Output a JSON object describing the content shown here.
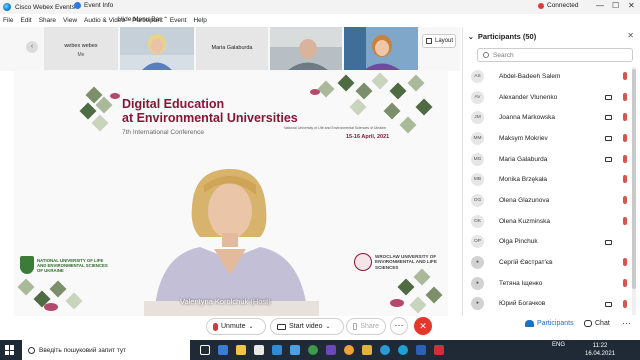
{
  "titlebar": {
    "app_title": "Cisco Webex Events",
    "event_info": "Event Info",
    "connection_status": "Connected",
    "connection_color": "#e23a3a",
    "minimize": "—",
    "maximize": "☐",
    "close": "✕"
  },
  "menubar": {
    "items": [
      "File",
      "Edit",
      "Share",
      "View",
      "Audio & Video",
      "Participant",
      "Event",
      "Help"
    ],
    "hide_menu_bar": "Hide Menu Bar",
    "hide_menu_chevron": "⌃"
  },
  "strip": {
    "prev_icon": "chevron-left-icon",
    "next_icon": "chevron-right-icon",
    "tiles": [
      {
        "name": "webex webex",
        "sub": "Me"
      },
      {
        "name": "",
        "sub": ""
      },
      {
        "name": "Maria Galaburda",
        "sub": ""
      },
      {
        "name": "",
        "sub": ""
      },
      {
        "name": "",
        "sub": ""
      }
    ],
    "layout_label": "Layout"
  },
  "slide": {
    "title_line1": "Digital Education",
    "title_line2": "at Environmental Universities",
    "subtitle": "7th International Conference",
    "uni_small": "National University of Life and Environmental Sciences of Ukraine",
    "date": "15-16 April, 2021",
    "left_logo": "NATIONAL UNIVERSITY OF LIFE AND ENVIRONMENTAL SCIENCES OF UKRAINE",
    "right_logo": "WROCLAW UNIVERSITY OF ENVIRONMENTAL AND LIFE SCIENCES",
    "accent_color": "#8a1434"
  },
  "stage": {
    "presenter_name": "Valentyna Korolchuk",
    "presenter_role": "(Host)"
  },
  "controls": {
    "unmute": "Unmute",
    "start_video": "Start video",
    "share": "Share",
    "more": "⋯",
    "leave": "✕",
    "participants": "Participants",
    "chat": "Chat",
    "panel_more": "⋯"
  },
  "panel": {
    "title": "Participants (50)",
    "close": "✕",
    "search_placeholder": "Search",
    "participants": [
      {
        "initials": "AS",
        "name": "Abdel-Badeeh Salem",
        "video": false
      },
      {
        "initials": "AV",
        "name": "Alexander Vlunenko",
        "video": true
      },
      {
        "initials": "JM",
        "name": "Joanna Markowska",
        "video": true
      },
      {
        "initials": "MM",
        "name": "Maksym Mokriev",
        "video": true
      },
      {
        "initials": "MG",
        "name": "Maria Galaburda",
        "video": true
      },
      {
        "initials": "MB",
        "name": "Monika Brzękała",
        "video": false
      },
      {
        "initials": "OG",
        "name": "Olena Glazunova",
        "video": false
      },
      {
        "initials": "OK",
        "name": "Olena Kuzminska",
        "video": false
      },
      {
        "initials": "OP",
        "name": "Olga Pinchuk",
        "video": true
      },
      {
        "initials": "",
        "name": "Сергій Євстрат'єв",
        "video": false
      },
      {
        "initials": "",
        "name": "Тетяна Іщенко",
        "video": false
      },
      {
        "initials": "",
        "name": "Юрий Богачков",
        "video": true
      }
    ]
  },
  "taskbar": {
    "search_placeholder": "Введіть пошуковий запит тут",
    "lang": "ENG",
    "time": "11:22",
    "date": "16.04.2021"
  }
}
